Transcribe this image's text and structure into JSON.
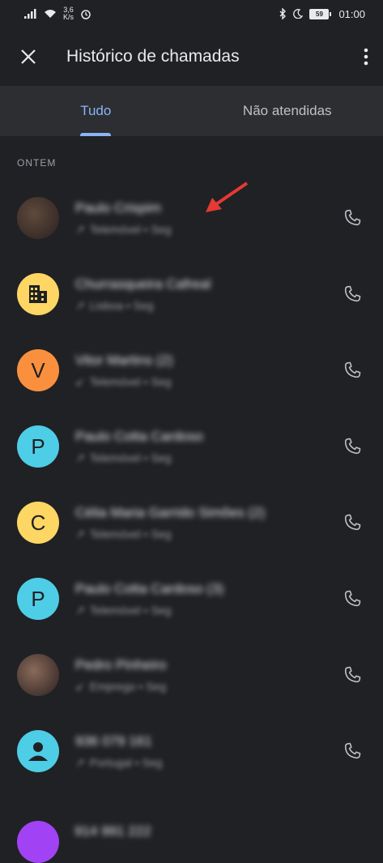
{
  "status": {
    "speed_value": "3,6",
    "speed_unit": "K/s",
    "battery": "59",
    "time": "01:00"
  },
  "appbar": {
    "title": "Histórico de chamadas"
  },
  "tabs": [
    {
      "label": "Tudo"
    },
    {
      "label": "Não atendidas"
    }
  ],
  "section": "ONTEM",
  "calls": [
    {
      "name": "Paulo Crispim",
      "meta": "Telemóvel • Seg",
      "avatar_letter": "",
      "avatar_color": "#5f4a3c",
      "type": "outgoing"
    },
    {
      "name": "Churrasqueira Cafreal",
      "meta": "Lisboa • Seg",
      "avatar_letter": "",
      "avatar_color": "#fdd663",
      "type": "outgoing"
    },
    {
      "name": "Vitor Martins (2)",
      "meta": "Telemóvel • Seg",
      "avatar_letter": "V",
      "avatar_color": "#fa903e",
      "type": "incoming"
    },
    {
      "name": "Paulo Cotta Cardoso",
      "meta": "Telemóvel • Seg",
      "avatar_letter": "P",
      "avatar_color": "#4ecde6",
      "type": "outgoing"
    },
    {
      "name": "Célia Maria Garrido Simões (2)",
      "meta": "Telemóvel • Seg",
      "avatar_letter": "C",
      "avatar_color": "#fdd663",
      "type": "outgoing"
    },
    {
      "name": "Paulo Cotta Cardoso (3)",
      "meta": "Telemóvel • Seg",
      "avatar_letter": "P",
      "avatar_color": "#4ecde6",
      "type": "outgoing"
    },
    {
      "name": "Pedro Pinheiro",
      "meta": "Emprego • Seg",
      "avatar_letter": "",
      "avatar_color": "#8a6a5a",
      "type": "incoming"
    },
    {
      "name": "936 079 161",
      "meta": "Portugal • Seg",
      "avatar_letter": "",
      "avatar_color": "#4ecde6",
      "type": "outgoing"
    }
  ],
  "partial_row": {
    "name": "914 991 222"
  }
}
